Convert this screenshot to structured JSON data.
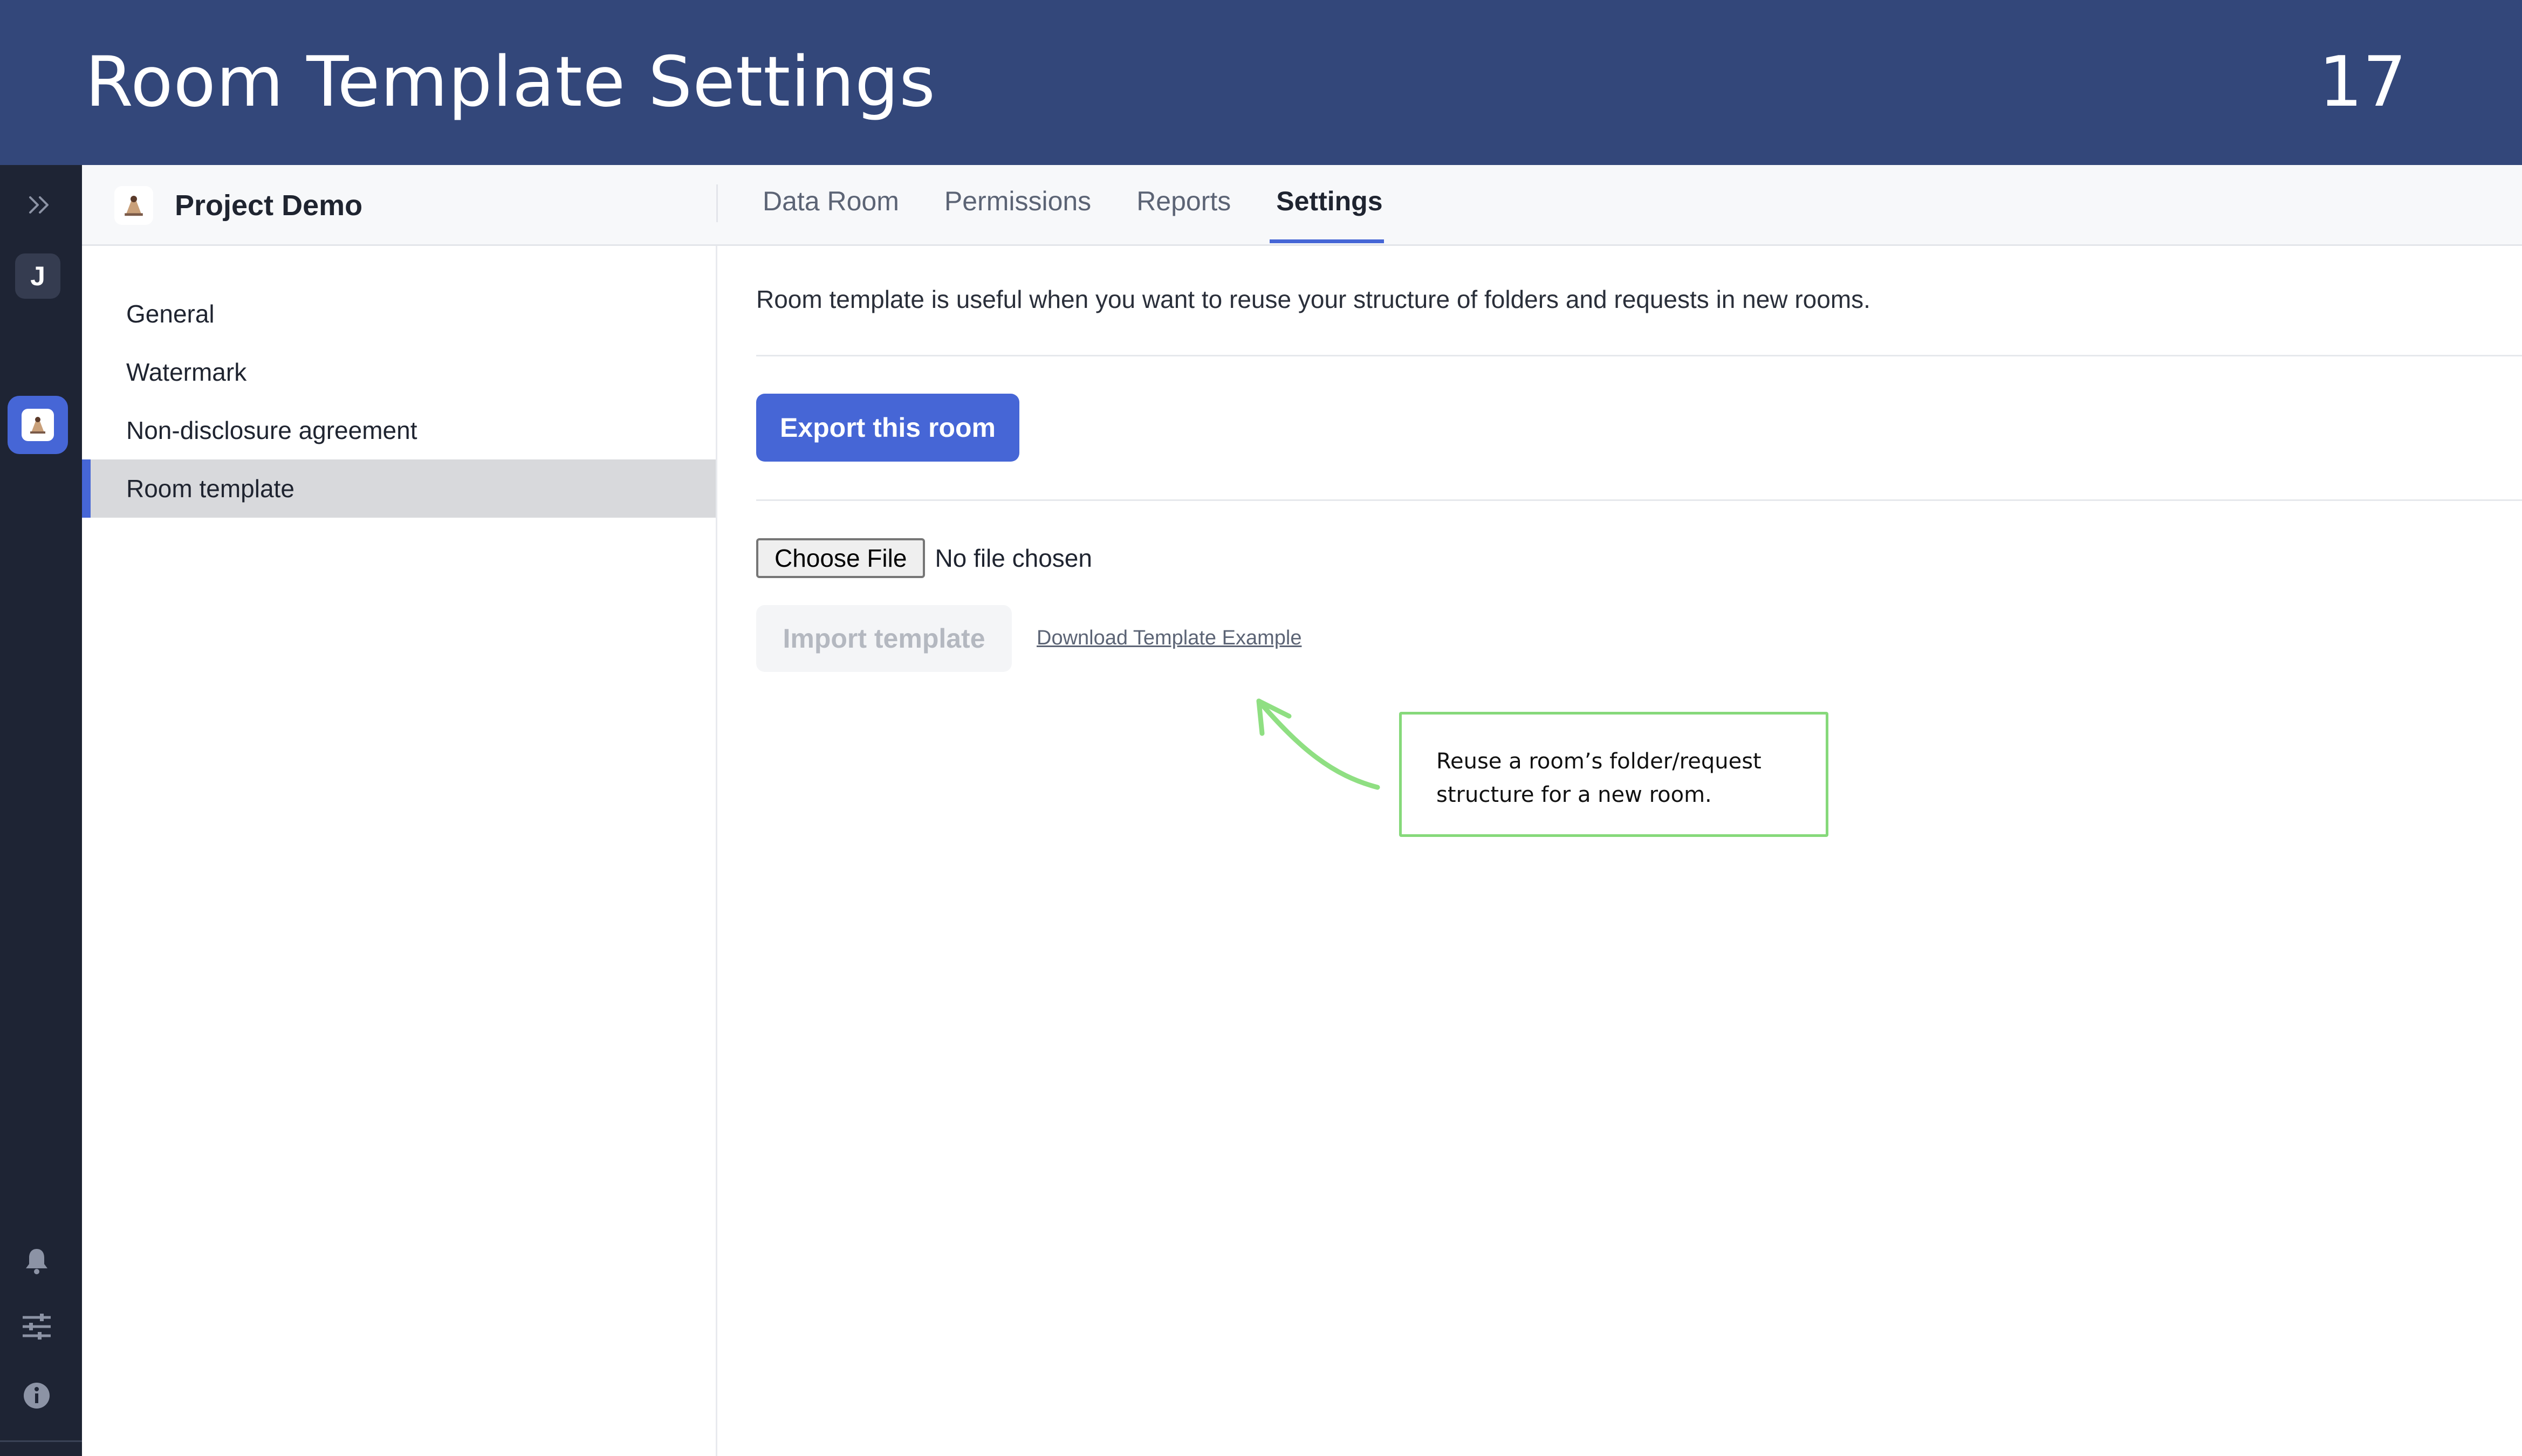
{
  "banner": {
    "title": "Room Template Settings",
    "page_number": "17"
  },
  "rail": {
    "expand_icon": "chevrons-right-icon",
    "avatar_initial": "J",
    "app_icon": "project-logo-icon",
    "bottom_icons": [
      "bell-icon",
      "sliders-icon",
      "info-icon"
    ]
  },
  "topbar": {
    "project_name": "Project Demo",
    "tabs": [
      {
        "label": "Data Room",
        "active": false
      },
      {
        "label": "Permissions",
        "active": false
      },
      {
        "label": "Reports",
        "active": false
      },
      {
        "label": "Settings",
        "active": true
      }
    ]
  },
  "sidebar": {
    "items": [
      {
        "label": "General",
        "active": false
      },
      {
        "label": "Watermark",
        "active": false
      },
      {
        "label": "Non-disclosure agreement",
        "active": false
      },
      {
        "label": "Room template",
        "active": true
      }
    ]
  },
  "main": {
    "description": "Room template is useful when you want to reuse your structure of folders and requests in new rooms.",
    "export_button": "Export this room",
    "file_button": "Choose File",
    "file_status": "No file chosen",
    "import_button": "Import template",
    "download_link": "Download Template Example"
  },
  "callout": {
    "text": "Reuse a room’s folder/request structure for a new room."
  },
  "colors": {
    "banner": "#33477a",
    "rail": "#1e2434",
    "accent": "#4666d6",
    "callout_border": "#86d97a",
    "arrow": "#8fdf82"
  }
}
